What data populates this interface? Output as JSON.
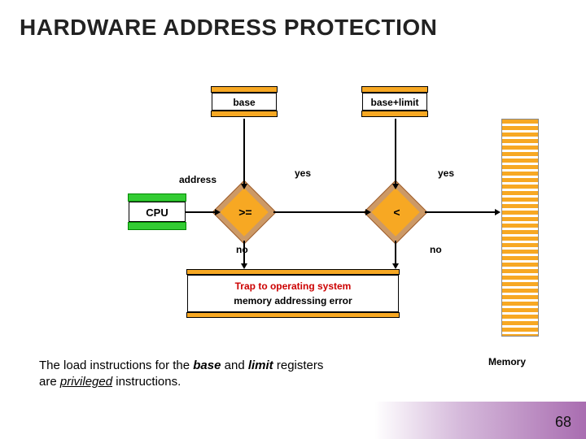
{
  "title": "HARDWARE ADDRESS PROTECTION",
  "boxes": {
    "base": "base",
    "base_plus_limit": "base+limit",
    "cpu": "CPU",
    "memory": "Memory"
  },
  "decisions": {
    "ge": ">=",
    "lt": "<"
  },
  "edges": {
    "address": "address",
    "yes1": "yes",
    "yes2": "yes",
    "no1": "no",
    "no2": "no"
  },
  "trap": {
    "line1": "Trap to operating system",
    "line2": "memory addressing error"
  },
  "caption": {
    "prefix": "The load instructions for the ",
    "base": "base",
    "mid": " and ",
    "limit": "limit",
    "suffix": " registers are ",
    "priv": "privileged",
    "end": " instructions."
  },
  "page": "68"
}
